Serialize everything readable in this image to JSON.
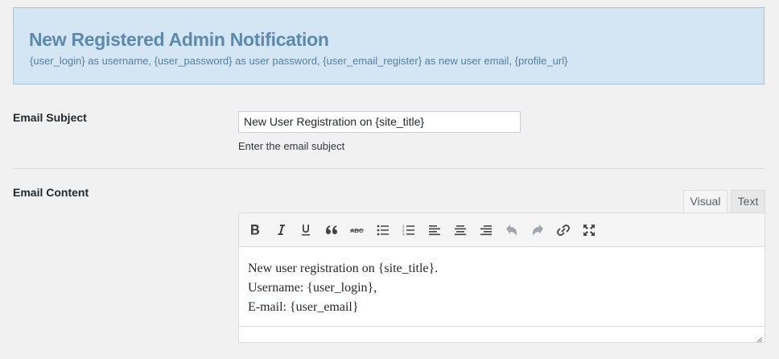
{
  "notice": {
    "title": "New Registered Admin Notification",
    "description": "{user_login} as username, {user_password} as user password, {user_email_register} as new user email, {profile_url}"
  },
  "subject": {
    "label": "Email Subject",
    "value": "New User Registration on {site_title}",
    "hint": "Enter the email subject"
  },
  "content": {
    "label": "Email Content",
    "tabs": [
      {
        "label": "Visual",
        "active": true
      },
      {
        "label": "Text",
        "active": false
      }
    ],
    "toolbar_icons": [
      "bold-icon",
      "italic-icon",
      "underline-icon",
      "blockquote-icon",
      "strikethrough-icon",
      "bullet-list-icon",
      "numbered-list-icon",
      "align-left-icon",
      "align-center-icon",
      "align-right-icon",
      "undo-icon",
      "redo-icon",
      "link-icon",
      "fullscreen-icon"
    ],
    "lines": [
      "New user registration on {site_title}.",
      "Username: {user_login},",
      "E-mail: {user_email}"
    ]
  },
  "colors": {
    "notice_bg": "#d4e5f3",
    "notice_border": "#a9c3d9",
    "notice_title": "#5c89ad"
  }
}
